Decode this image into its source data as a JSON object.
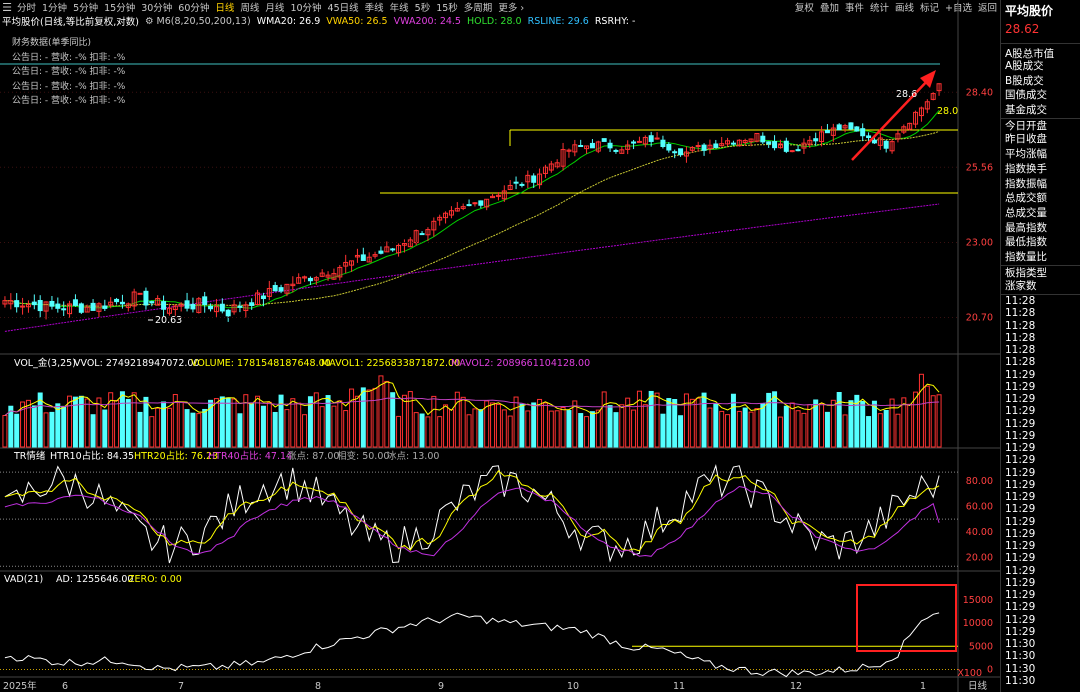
{
  "period_tabs": [
    "分时",
    "1分钟",
    "5分钟",
    "15分钟",
    "30分钟",
    "60分钟",
    "日线",
    "周线",
    "月线",
    "10分钟",
    "45日线",
    "季线",
    "年线",
    "5秒",
    "15秒",
    "多周期",
    "更多 ›"
  ],
  "active_tab": "日线",
  "tools": [
    "复权",
    "叠加",
    "事件",
    "统计",
    "画线",
    "标记",
    "+自选",
    "返回"
  ],
  "title": {
    "name": "平均股价(日线,等比前复权,对数)",
    "ma_menu": "M6(8,20,50,200,13)",
    "wma20": "WMA20: 26.9",
    "vwa50": "VWA50: 26.5",
    "vwa200": "VWA200: 24.5",
    "hold": "HOLD: 28.0",
    "rsline": "RSLINE: 29.6",
    "rsrhy": "RSRHY: -"
  },
  "financial": {
    "header": "财务数据(单季同比)",
    "rows": [
      "公告日: -   营收: -%   扣非: -%",
      "公告日: -   营收: -%   扣非: -%",
      "公告日: -   营收: -%   扣非: -%",
      "公告日: -   营收: -%   扣非: -%"
    ]
  },
  "sidebar": {
    "name": "平均股价",
    "price": "28.62",
    "header": "A股总市值",
    "items": [
      "A股成交",
      "B股成交",
      "国债成交",
      "基金成交",
      "今日开盘",
      "昨日收盘",
      "平均涨幅",
      "指数换手",
      "指数振幅",
      "总成交额",
      "总成交量",
      "最高指数",
      "最低指数",
      "指数量比",
      "板指类型",
      "涨家数"
    ],
    "times": [
      "11:28",
      "11:28",
      "11:28",
      "11:28",
      "11:28",
      "11:28",
      "11:29",
      "11:29",
      "11:29",
      "11:29",
      "11:29",
      "11:29",
      "11:29",
      "11:29",
      "11:29",
      "11:29",
      "11:29",
      "11:29",
      "11:29",
      "11:29",
      "11:29",
      "11:29",
      "11:29",
      "11:29",
      "11:29",
      "11:29",
      "11:29",
      "11:29",
      "11:30",
      "11:30",
      "11:30",
      "11:30"
    ]
  },
  "vol_title": {
    "name": "VOL_金(3,25)",
    "vvol": "VVOL: 2749218947072.00",
    "volume": "VOLUME: 1781548187648.00",
    "mavol1": "MAVOL1: 2256833871872.00",
    "mavol2": "MAVOL2: 2089661104128.00"
  },
  "tr_title": {
    "name": "TR情绪",
    "htr10": "HTR10占比: 84.35",
    "htr20": "HTR20占比: 76.23",
    "htr40": "HTR40占比: 47.14",
    "up": "涨点: 87.00",
    "mid": "相变: 50.00",
    "down": "冰点: 13.00"
  },
  "vad_title": {
    "name": "VAD(21)",
    "ad": "AD: 1255646.00",
    "zero": "ZERO: 0.00"
  },
  "colors": {
    "up": "#ff3232",
    "down": "#54ffff",
    "ma_short": "#00d000",
    "ma_mid": "#c8c832",
    "ma_long": "#b000d0",
    "yellow": "#ffff00",
    "white": "#ffffff",
    "highlight": "#ff2020"
  },
  "chart_data": [
    {
      "type": "candlestick",
      "yaxis_ticks": [
        20.7,
        23.0,
        25.56,
        28.4
      ],
      "ylim": [
        20.0,
        29.8
      ],
      "annotations": [
        "20.63",
        "28.6",
        "28.0"
      ],
      "series_note": "daily OHLC, approximate",
      "open_close_ranges": "see script"
    },
    {
      "type": "bar",
      "name": "VOL",
      "yaxis_ticks": [],
      "series": [
        {
          "name": "MAVOL1"
        },
        {
          "name": "MAVOL2"
        }
      ]
    },
    {
      "type": "line",
      "name": "TR",
      "yaxis_ticks": [
        20.0,
        40.0,
        60.0,
        80.0
      ],
      "ylim": [
        10,
        95
      ],
      "series": [
        {
          "name": "HTR10占比",
          "last": 84.35
        },
        {
          "name": "HTR20占比",
          "last": 76.23
        },
        {
          "name": "HTR40占比",
          "last": 47.14
        }
      ],
      "reference_levels": [
        87,
        50,
        13
      ]
    },
    {
      "type": "line",
      "name": "VAD",
      "yaxis_ticks": [
        0,
        5000,
        10000,
        15000
      ],
      "ylim": [
        -1200,
        18000
      ],
      "unit": "X100"
    }
  ],
  "xaxis": {
    "labels": [
      "2025年",
      "6",
      "7",
      "8",
      "9",
      "10",
      "11",
      "12",
      "1"
    ],
    "period_label": "日线"
  }
}
